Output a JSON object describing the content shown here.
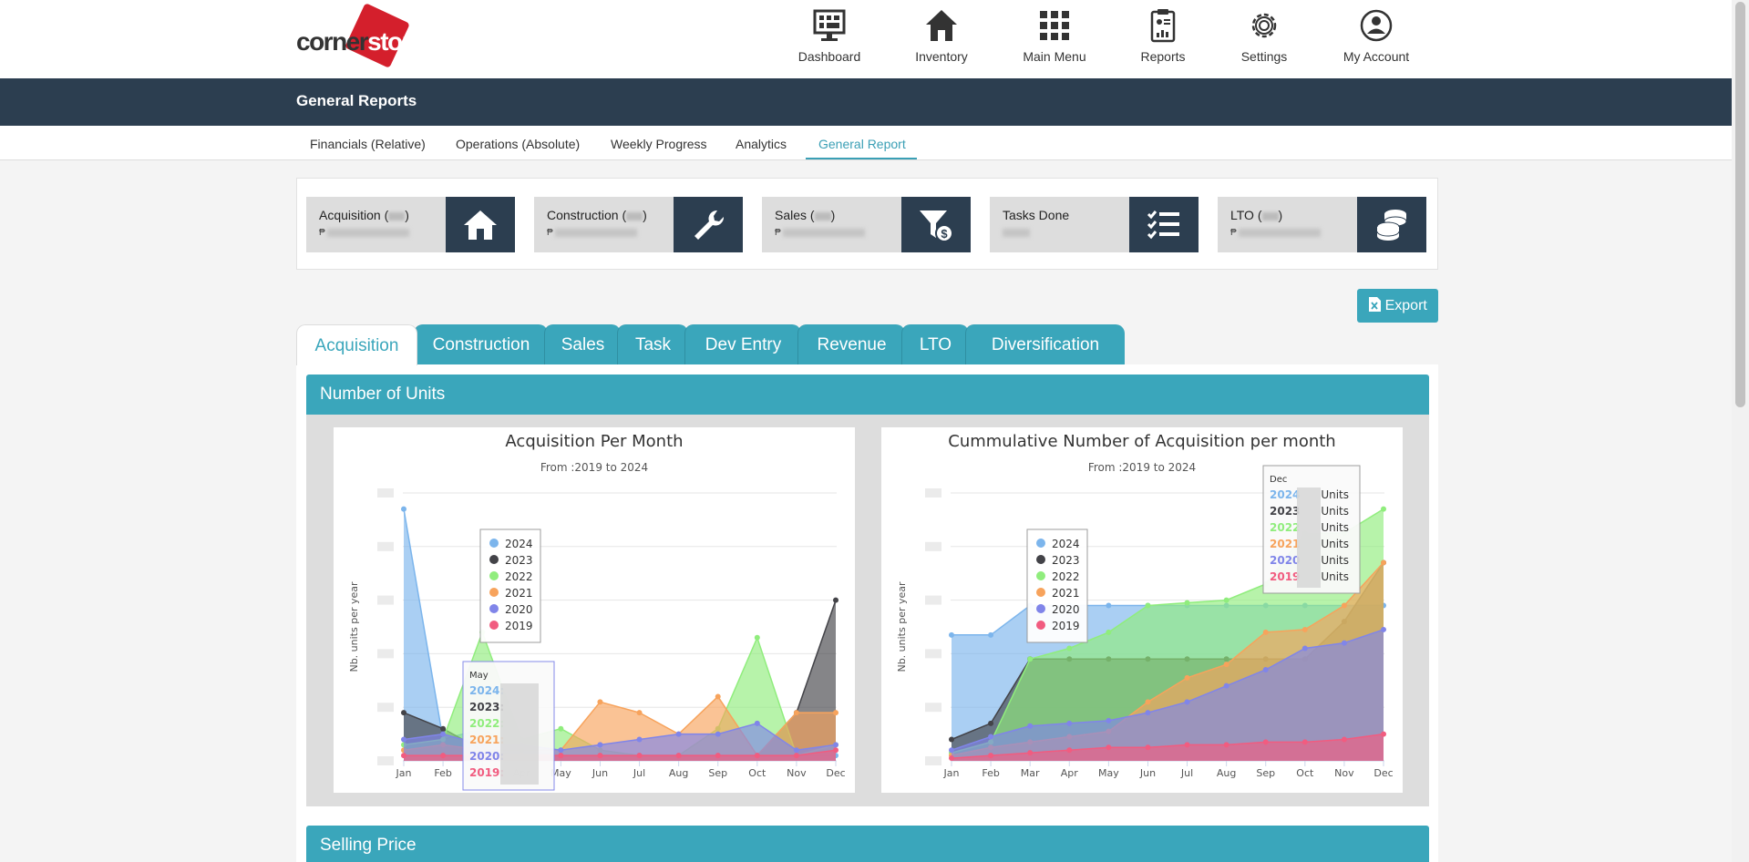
{
  "brand": {
    "part1": "corner",
    "part2": "stone"
  },
  "nav": [
    {
      "label": "Dashboard",
      "icon": "monitor-icon"
    },
    {
      "label": "Inventory",
      "icon": "house-icon"
    },
    {
      "label": "Main Menu",
      "icon": "grid-icon"
    },
    {
      "label": "Reports",
      "icon": "clipboard-report-icon"
    },
    {
      "label": "Settings",
      "icon": "gear-icon"
    },
    {
      "label": "My Account",
      "icon": "user-circle-icon"
    }
  ],
  "page_title": "General Reports",
  "subnav": [
    "Financials (Relative)",
    "Operations (Absolute)",
    "Weekly Progress",
    "Analytics",
    "General Report"
  ],
  "subnav_active": "General Report",
  "stats": [
    {
      "name": "Acquisition (",
      "suffix": ")",
      "currency": "₱",
      "icon": "house-icon"
    },
    {
      "name": "Construction (",
      "suffix": ")",
      "currency": "₱",
      "icon": "wrench-icon"
    },
    {
      "name": "Sales (",
      "suffix": ")",
      "currency": "₱",
      "icon": "funnel-dollar-icon"
    },
    {
      "name": "Tasks Done",
      "suffix": "",
      "currency": "",
      "icon": "checklist-icon"
    },
    {
      "name": "LTO (",
      "suffix": ")",
      "currency": "₱",
      "icon": "coins-icon"
    }
  ],
  "export_label": "Export",
  "tabs": [
    "Acquisition",
    "Construction",
    "Sales",
    "Task",
    "Dev Entry",
    "Revenue",
    "LTO",
    "Diversification"
  ],
  "active_tab": "Acquisition",
  "section_title": "Number of Units",
  "section2_title": "Selling Price",
  "colors": {
    "2024": "#7cb5ec",
    "2023": "#434348",
    "2022": "#90ed7d",
    "2021": "#f7a35c",
    "2020": "#8085e9",
    "2019": "#f15c80",
    "accent": "#3aa6bb",
    "dark": "#2c3e50"
  },
  "chart_data": [
    {
      "type": "area",
      "title": "Acquisition Per Month",
      "subtitle": "From :2019 to 2024",
      "ylabel": "Nb. units per year",
      "categories": [
        "Jan",
        "Feb",
        "Mar",
        "Apr",
        "May",
        "Jun",
        "Jul",
        "Aug",
        "Sep",
        "Oct",
        "Nov",
        "Dec"
      ],
      "ylim": [
        0,
        5
      ],
      "series": [
        {
          "name": "2024",
          "values": [
            4.7,
            0.4,
            0.6,
            0.2,
            0.1,
            0.1,
            0.1,
            0.1,
            0.1,
            0.1,
            0.1,
            0.1
          ]
        },
        {
          "name": "2023",
          "values": [
            0.9,
            0.6,
            0.2,
            0.1,
            0.1,
            0.1,
            0.1,
            0.1,
            0.1,
            0.1,
            0.9,
            3.0
          ]
        },
        {
          "name": "2022",
          "values": [
            0.3,
            0.4,
            2.4,
            0.4,
            0.6,
            0.2,
            0.1,
            0.1,
            0.6,
            2.3,
            0.1,
            0.3
          ]
        },
        {
          "name": "2021",
          "values": [
            0.2,
            0.3,
            0.2,
            0.2,
            0.2,
            1.1,
            0.9,
            0.5,
            1.2,
            0.1,
            0.9,
            0.9
          ]
        },
        {
          "name": "2020",
          "values": [
            0.4,
            0.5,
            0.3,
            0.3,
            0.2,
            0.3,
            0.4,
            0.5,
            0.5,
            0.7,
            0.2,
            0.3
          ]
        },
        {
          "name": "2019",
          "values": [
            0.1,
            0.1,
            0.1,
            0.1,
            0.1,
            0.1,
            0.1,
            0.1,
            0.1,
            0.1,
            0.1,
            0.2
          ]
        }
      ],
      "legend": [
        "2024",
        "2023",
        "2022",
        "2021",
        "2020",
        "2019"
      ],
      "tooltip": {
        "header": "May",
        "rows": [
          "2024:",
          "2023:",
          "2022:",
          "2021:",
          "2020:",
          "2019:"
        ]
      }
    },
    {
      "type": "area",
      "title": "Cummulative Number of Acquisition per month",
      "subtitle": "From :2019 to 2024",
      "ylabel": "Nb. units per year",
      "categories": [
        "Jan",
        "Feb",
        "Mar",
        "Apr",
        "May",
        "Jun",
        "Jul",
        "Aug",
        "Sep",
        "Oct",
        "Nov",
        "Dec"
      ],
      "ylim": [
        0,
        100
      ],
      "series": [
        {
          "name": "2024",
          "values": [
            47,
            47,
            58,
            58,
            58,
            58,
            58,
            58,
            58,
            58,
            58,
            58
          ]
        },
        {
          "name": "2023",
          "values": [
            8,
            14,
            38,
            38,
            38,
            38,
            38,
            38,
            38,
            38,
            52,
            74
          ]
        },
        {
          "name": "2022",
          "values": [
            3,
            7,
            38,
            42,
            48,
            58,
            59,
            60,
            66,
            85,
            85,
            94
          ]
        },
        {
          "name": "2021",
          "values": [
            2,
            5,
            7,
            9,
            11,
            22,
            31,
            36,
            48,
            49,
            58,
            74
          ]
        },
        {
          "name": "2020",
          "values": [
            4,
            9,
            13,
            14,
            15,
            18,
            22,
            28,
            34,
            42,
            44,
            49
          ]
        },
        {
          "name": "2019",
          "values": [
            1,
            2,
            3,
            4,
            5,
            5,
            6,
            6,
            7,
            7,
            8,
            10
          ]
        }
      ],
      "legend": [
        "2024",
        "2023",
        "2022",
        "2021",
        "2020",
        "2019"
      ],
      "tooltip": {
        "header": "Dec",
        "rows": [
          "2024",
          "2023",
          "2022",
          "2021",
          "2020",
          "2019"
        ],
        "unit": "Units"
      }
    }
  ]
}
